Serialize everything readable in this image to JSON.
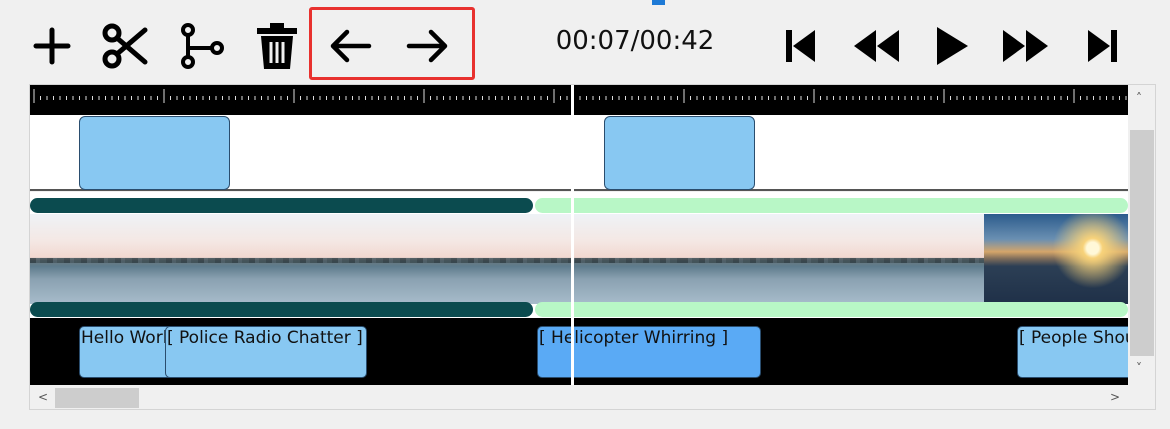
{
  "toolbar": {
    "time_readout": "00:07/00:42",
    "accent_highlight": "#e8312e"
  },
  "timeline": {
    "audio_clips": [
      {
        "label": "Hello World"
      },
      {
        "label": "[ Police Radio Chatter ]"
      },
      {
        "label": "[ Helicopter Whirring ]"
      },
      {
        "label": "[ People Shouting ]"
      }
    ]
  },
  "scrollbars": {
    "up_arrow": "˄",
    "down_arrow": "˅",
    "left_arrow": "<",
    "right_arrow": ">"
  }
}
